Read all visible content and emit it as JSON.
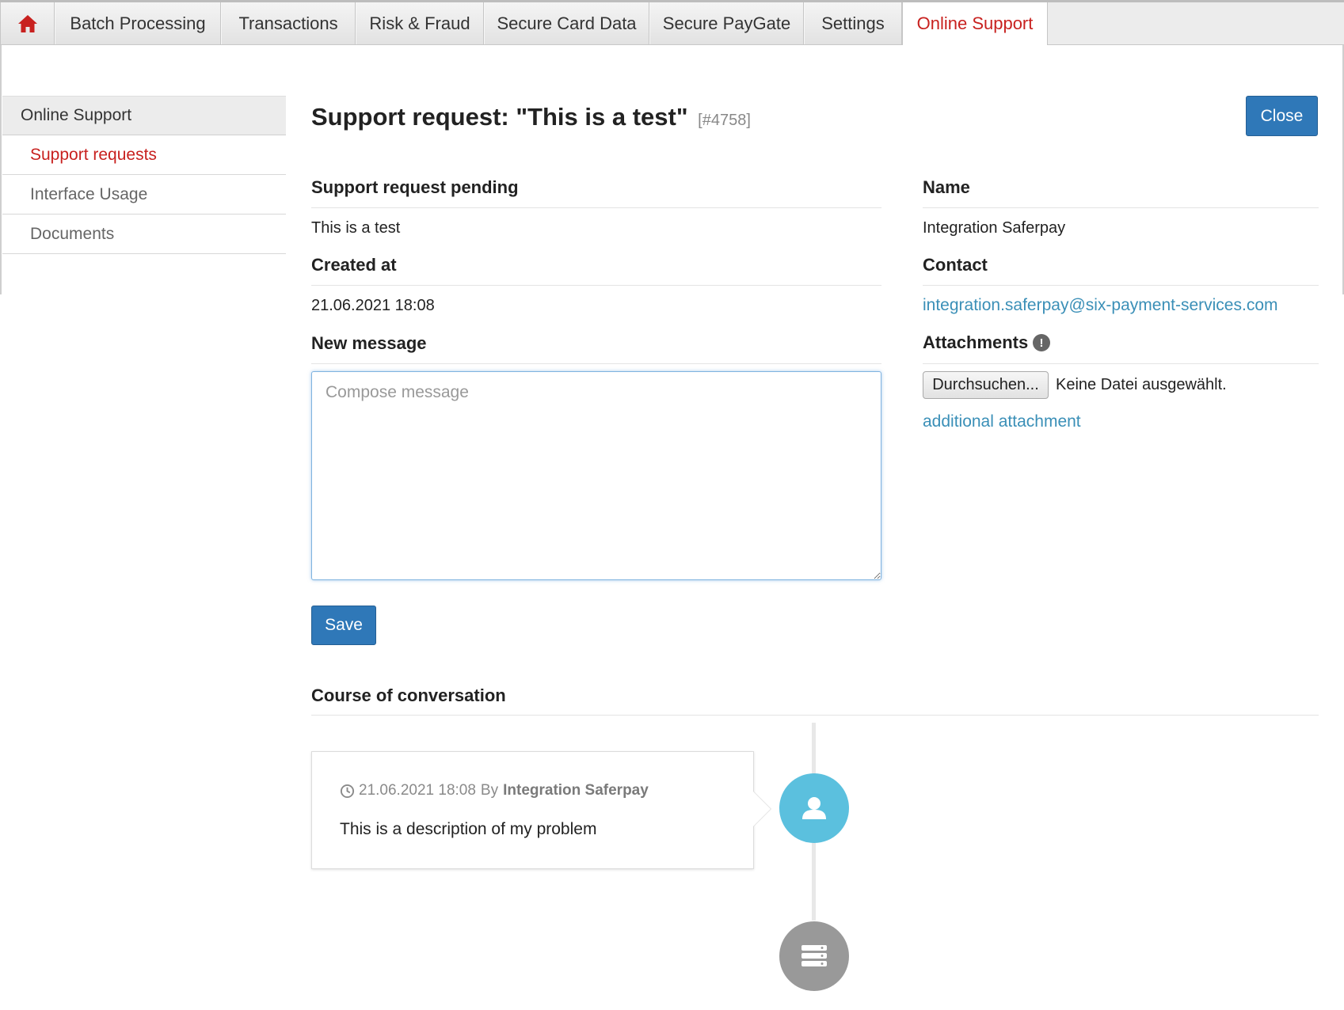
{
  "nav": {
    "tabs": [
      {
        "label": "Batch Processing"
      },
      {
        "label": "Transactions"
      },
      {
        "label": "Risk & Fraud"
      },
      {
        "label": "Secure Card Data"
      },
      {
        "label": "Secure PayGate"
      },
      {
        "label": "Settings"
      },
      {
        "label": "Online Support",
        "active": true
      }
    ],
    "home_icon": "home-icon",
    "accent_color": "#c8211f"
  },
  "sidebar": {
    "header": "Online Support",
    "items": [
      {
        "label": "Support requests",
        "active": true
      },
      {
        "label": "Interface Usage"
      },
      {
        "label": "Documents"
      }
    ]
  },
  "request": {
    "title": "Support request: \"This is a test\"",
    "ref": "[#4758]",
    "close_label": "Close",
    "status_label": "Support request pending",
    "subject": "This is a test",
    "created_label": "Created at",
    "created_value": "21.06.2021 18:08",
    "new_message_label": "New message",
    "message_placeholder": "Compose message",
    "message_value": "",
    "save_label": "Save"
  },
  "details": {
    "name_label": "Name",
    "name_value": "Integration Saferpay",
    "contact_label": "Contact",
    "contact_value": "integration.saferpay@six-payment-services.com",
    "attachments_label": "Attachments",
    "attachments_info_icon": "exclamation-icon",
    "file_button_label": "Durchsuchen...",
    "file_status": "Keine Datei ausgewählt.",
    "additional_attachment_label": "additional attachment"
  },
  "conversation": {
    "heading": "Course of conversation",
    "entries": [
      {
        "timestamp": "21.06.2021 18:08",
        "by_word": "By",
        "author": "Integration Saferpay",
        "text": "This is a description of my problem",
        "icon": "user-icon"
      }
    ],
    "end_icon": "server-icon"
  },
  "colors": {
    "primary_button": "#2f78b8",
    "link": "#3a8fb7",
    "user_circle": "#5bc0de",
    "server_circle": "#999999"
  }
}
